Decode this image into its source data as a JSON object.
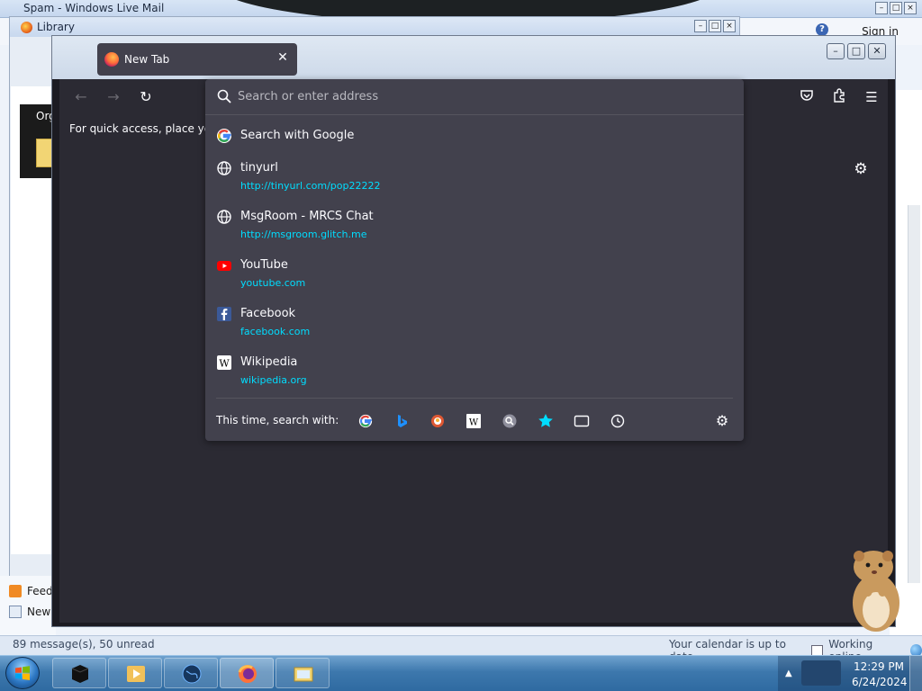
{
  "wlm": {
    "title": "Spam - Windows Live Mail",
    "sign_in": "Sign in",
    "left_items": [
      "Feed",
      "New"
    ],
    "status_left": "89 message(s), 50 unread",
    "status_calendar": "Your calendar is up to date",
    "status_online": "Working online"
  },
  "library": {
    "title": "Library",
    "organize_label": "Org"
  },
  "firefox": {
    "tab_title": "New Tab",
    "bookmarks_hint": "For quick access, place your b",
    "urlbar_placeholder": "Search or enter address",
    "suggestions": [
      {
        "title": "Search with Google",
        "url": "",
        "icon": "google-icon"
      },
      {
        "title": "tinyurl",
        "url": "http://tinyurl.com/pop22222",
        "icon": "globe-icon"
      },
      {
        "title": "MsgRoom - MRCS Chat",
        "url": "http://msgroom.glitch.me",
        "icon": "globe-icon"
      },
      {
        "title": "YouTube",
        "url": "youtube.com",
        "icon": "youtube-icon"
      },
      {
        "title": "Facebook",
        "url": "facebook.com",
        "icon": "facebook-icon"
      },
      {
        "title": "Wikipedia",
        "url": "wikipedia.org",
        "icon": "wikipedia-icon"
      }
    ],
    "oneoff_label": "This time, search with:",
    "oneoff_engines": [
      "google-icon",
      "bing-icon",
      "duckduckgo-icon",
      "wikipedia-icon",
      "search-engine-icon",
      "bookmarks-star-icon",
      "tabs-icon",
      "history-icon"
    ]
  },
  "taskbar": {
    "time": "12:29 PM",
    "date": "6/24/2024"
  },
  "colors": {
    "ff_bg": "#2b2a33",
    "ff_panel": "#42414d",
    "url_accent": "#00ddff",
    "text_light": "#fbfbfe"
  }
}
